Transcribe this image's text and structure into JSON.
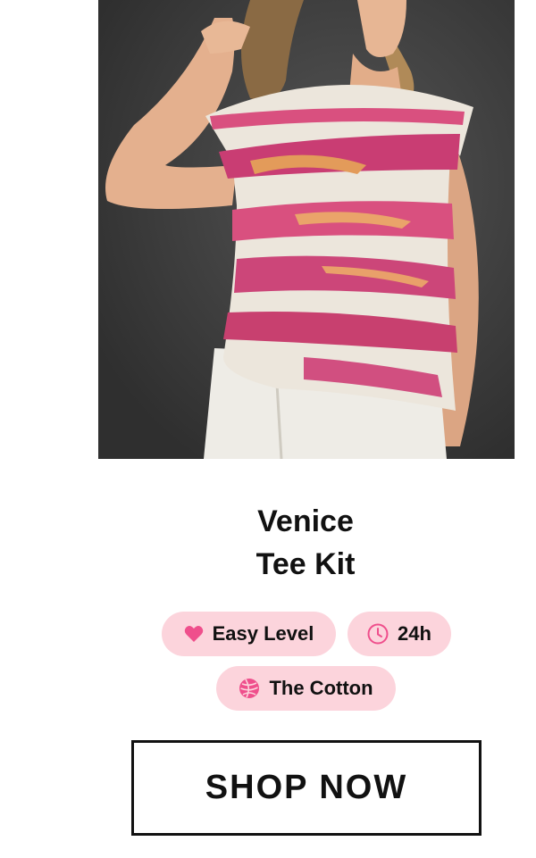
{
  "product": {
    "title_line1": "Venice",
    "title_line2": "Tee Kit",
    "image_alt": "Model wearing pink and white striped knitted tee"
  },
  "badges": {
    "level": {
      "label": "Easy Level",
      "icon": "heart-icon"
    },
    "time": {
      "label": "24h",
      "icon": "clock-icon"
    },
    "yarn": {
      "label": "The Cotton",
      "icon": "yarn-ball-icon"
    }
  },
  "cta": {
    "label": "SHOP NOW"
  },
  "colors": {
    "badge_bg": "#fcd4dc",
    "icon_pink": "#ef4f8c",
    "text": "#111111"
  }
}
